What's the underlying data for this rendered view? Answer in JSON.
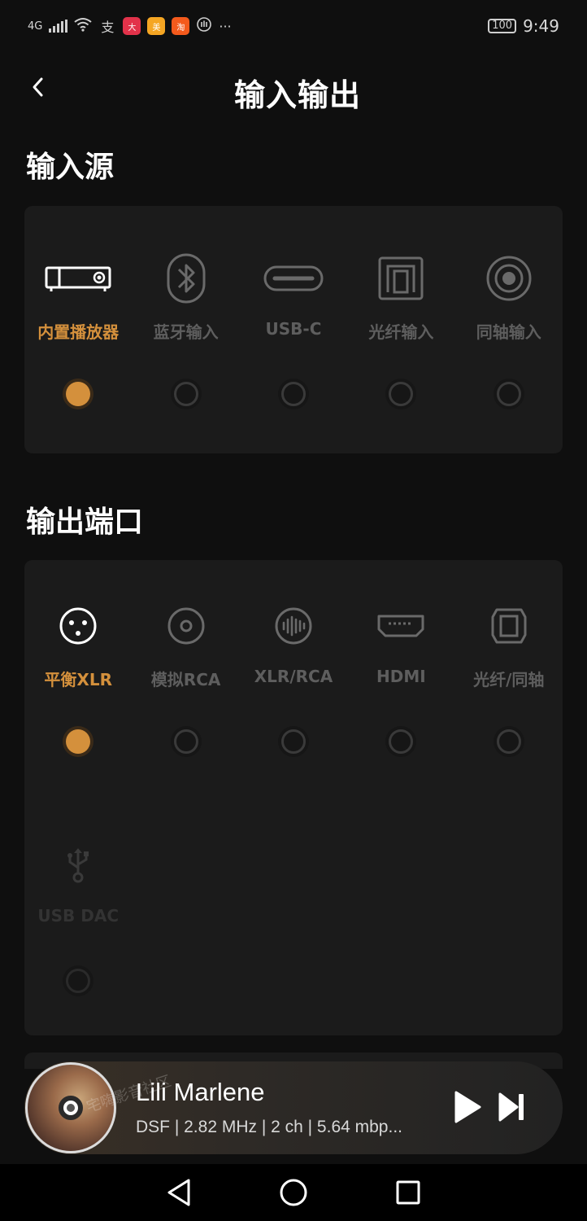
{
  "status_bar": {
    "network": "4G",
    "time": "9:49",
    "battery": "100",
    "more": "···",
    "app_badges": [
      {
        "name": "alipay",
        "text": "支",
        "color": "#0f0f0f"
      },
      {
        "name": "dianping",
        "text": "大",
        "color": "#e2324a"
      },
      {
        "name": "meituan",
        "text": "美",
        "color": "#f5a623"
      },
      {
        "name": "taobao",
        "text": "淘",
        "color": "#f45a1c"
      }
    ]
  },
  "header": {
    "title": "输入输出",
    "back_icon": "chevron-left-icon"
  },
  "input_section": {
    "title": "输入源",
    "options": [
      {
        "label": "内置播放器",
        "icon": "player-device-icon",
        "selected": true
      },
      {
        "label": "蓝牙输入",
        "icon": "bluetooth-icon",
        "selected": false
      },
      {
        "label": "USB-C",
        "icon": "usb-c-icon",
        "selected": false
      },
      {
        "label": "光纤输入",
        "icon": "optical-port-icon",
        "selected": false
      },
      {
        "label": "同轴输入",
        "icon": "coaxial-icon",
        "selected": false
      }
    ]
  },
  "output_section": {
    "title": "输出端口",
    "options": [
      {
        "label": "平衡XLR",
        "icon": "xlr-icon",
        "selected": true
      },
      {
        "label": "模拟RCA",
        "icon": "rca-icon",
        "selected": false
      },
      {
        "label": "XLR/RCA",
        "icon": "xlr-rca-icon",
        "selected": false
      },
      {
        "label": "HDMI",
        "icon": "hdmi-icon",
        "selected": false
      },
      {
        "label": "光纤/同轴",
        "icon": "optical-coaxial-icon",
        "selected": false
      },
      {
        "label": "USB DAC",
        "icon": "usb-icon",
        "selected": false,
        "disabled": true
      }
    ]
  },
  "player": {
    "title": "Lili Marlene",
    "meta": "DSF | 2.82 MHz | 2 ch | 5.64 mbp...",
    "watermark": "宅嗨影音社区"
  },
  "colors": {
    "accent": "#d4903c",
    "background": "#0f0f0f",
    "card": "#1b1b1b",
    "inactive_text": "#5e5e5e"
  }
}
